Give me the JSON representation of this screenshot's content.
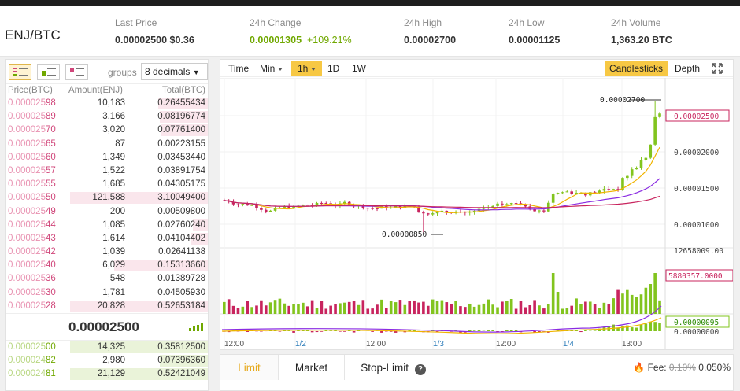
{
  "pair": "ENJ/BTC",
  "stats": [
    {
      "label": "Last Price",
      "value": "0.00002500",
      "extra": "$0.36"
    },
    {
      "label": "24h Change",
      "value": "0.00001305",
      "extra": "+109.21%"
    },
    {
      "label": "24h High",
      "value": "0.00002700"
    },
    {
      "label": "24h Low",
      "value": "0.00001125"
    },
    {
      "label": "24h Volume",
      "value": "1,363.20 BTC"
    }
  ],
  "book": {
    "groups_label": "groups",
    "decimals": "8 decimals",
    "cols": {
      "price": "Price(BTC)",
      "amount": "Amount(ENJ)",
      "total": "Total(BTC)"
    },
    "asks": [
      {
        "p1": "0.000025",
        "p2": "98",
        "amt": "10,183",
        "tot": "0.26455434",
        "w": 0.36
      },
      {
        "p1": "0.000025",
        "p2": "89",
        "amt": "3,166",
        "tot": "0.08196774",
        "w": 0.35
      },
      {
        "p1": "0.000025",
        "p2": "70",
        "amt": "3,020",
        "tot": "0.07761400",
        "w": 0.34
      },
      {
        "p1": "0.000025",
        "p2": "65",
        "amt": "87",
        "tot": "0.00223155",
        "w": 0
      },
      {
        "p1": "0.000025",
        "p2": "60",
        "amt": "1,349",
        "tot": "0.03453440",
        "w": 0
      },
      {
        "p1": "0.000025",
        "p2": "57",
        "amt": "1,522",
        "tot": "0.03891754",
        "w": 0
      },
      {
        "p1": "0.000025",
        "p2": "55",
        "amt": "1,685",
        "tot": "0.04305175",
        "w": 0
      },
      {
        "p1": "0.000025",
        "p2": "50",
        "amt": "121,588",
        "tot": "3.10049400",
        "w": 1
      },
      {
        "p1": "0.000025",
        "p2": "49",
        "amt": "200",
        "tot": "0.00509800",
        "w": 0
      },
      {
        "p1": "0.000025",
        "p2": "44",
        "amt": "1,085",
        "tot": "0.02760240",
        "w": 0.11
      },
      {
        "p1": "0.000025",
        "p2": "43",
        "amt": "1,614",
        "tot": "0.04104402",
        "w": 0.12
      },
      {
        "p1": "0.000025",
        "p2": "42",
        "amt": "1,039",
        "tot": "0.02641138",
        "w": 0
      },
      {
        "p1": "0.000025",
        "p2": "40",
        "amt": "6,029",
        "tot": "0.15313660",
        "w": 0.68
      },
      {
        "p1": "0.000025",
        "p2": "36",
        "amt": "548",
        "tot": "0.01389728",
        "w": 0
      },
      {
        "p1": "0.000025",
        "p2": "30",
        "amt": "1,781",
        "tot": "0.04505930",
        "w": 0
      },
      {
        "p1": "0.000025",
        "p2": "28",
        "amt": "20,828",
        "tot": "0.52653184",
        "w": 1
      }
    ],
    "last": "0.00002500",
    "bids": [
      {
        "p1": "0.000025",
        "p2": "00",
        "amt": "14,325",
        "tot": "0.35812500",
        "w": 1
      },
      {
        "p1": "0.000024",
        "p2": "82",
        "amt": "2,980",
        "tot": "0.07396360",
        "w": 0.35
      },
      {
        "p1": "0.000024",
        "p2": "81",
        "amt": "21,129",
        "tot": "0.52421049",
        "w": 1
      }
    ]
  },
  "chart": {
    "tools": {
      "time": "Time",
      "min": "Min",
      "interval": "1h",
      "d": "1D",
      "w": "1W",
      "candles": "Candlesticks",
      "depth": "Depth"
    },
    "price_labels": [
      "0.00002500",
      "0.00002000",
      "0.00001500",
      "0.00001000"
    ],
    "high_label": "0.00002700",
    "low_label": "0.00000850",
    "vol_labels": [
      "12658009.00",
      "5880357.0000"
    ],
    "ind_labels": [
      "0.00000095",
      "0.00000000"
    ],
    "x_labels": [
      "12:00",
      "1/2",
      "12:00",
      "1/3",
      "12:00",
      "1/4",
      "13:00"
    ]
  },
  "order": {
    "tabs": [
      "Limit",
      "Market",
      "Stop-Limit"
    ],
    "fee_label": "Fee:",
    "fee_old": "0.10%",
    "fee_new": "0.050%"
  }
}
